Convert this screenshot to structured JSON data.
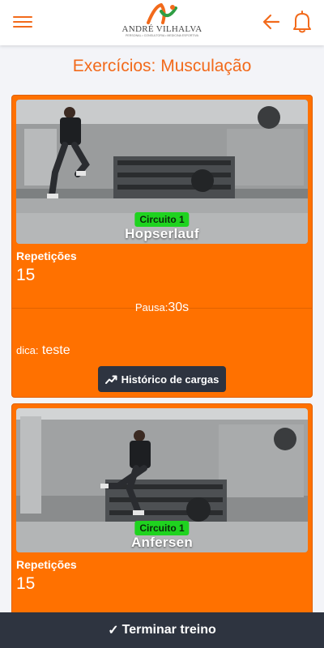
{
  "header": {
    "logo_name": "ANDRÉ VILHALVA",
    "logo_tagline": "PERSONAL • CONSULTORIA • MEDICINA ESPORTIVA"
  },
  "page": {
    "title": "Exercícios: Musculação"
  },
  "exercises": [
    {
      "circuit": "Circuito 1",
      "name": "Hopserlauf",
      "rep_label": "Repetições",
      "rep_value": "15",
      "pause_label": "Pausa:",
      "pause_value": "30s",
      "tip_label": "dica:",
      "tip_value": "teste",
      "history_button": "Histórico de cargas"
    },
    {
      "circuit": "Circuito 1",
      "name": "Anfersen",
      "rep_label": "Repetições",
      "rep_value": "15"
    }
  ],
  "footer": {
    "check": "✓",
    "finish_label": "Terminar treino"
  },
  "colors": {
    "accent": "#f26a1b",
    "card": "#ff7100",
    "dark_button": "#2e3440",
    "badge": "#1fd31f"
  }
}
